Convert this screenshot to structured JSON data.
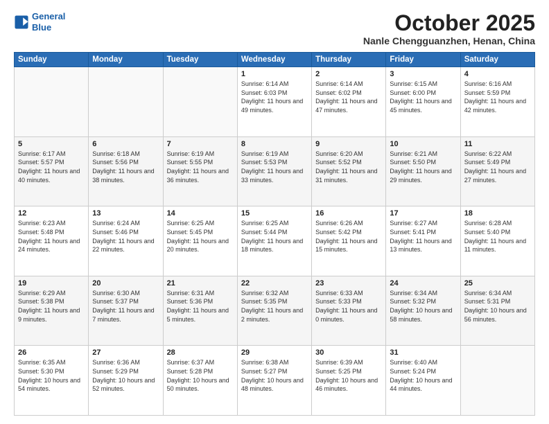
{
  "header": {
    "logo_line1": "General",
    "logo_line2": "Blue",
    "month": "October 2025",
    "location": "Nanle Chengguanzhen, Henan, China"
  },
  "weekdays": [
    "Sunday",
    "Monday",
    "Tuesday",
    "Wednesday",
    "Thursday",
    "Friday",
    "Saturday"
  ],
  "weeks": [
    [
      {
        "day": "",
        "info": ""
      },
      {
        "day": "",
        "info": ""
      },
      {
        "day": "",
        "info": ""
      },
      {
        "day": "1",
        "info": "Sunrise: 6:14 AM\nSunset: 6:03 PM\nDaylight: 11 hours\nand 49 minutes."
      },
      {
        "day": "2",
        "info": "Sunrise: 6:14 AM\nSunset: 6:02 PM\nDaylight: 11 hours\nand 47 minutes."
      },
      {
        "day": "3",
        "info": "Sunrise: 6:15 AM\nSunset: 6:00 PM\nDaylight: 11 hours\nand 45 minutes."
      },
      {
        "day": "4",
        "info": "Sunrise: 6:16 AM\nSunset: 5:59 PM\nDaylight: 11 hours\nand 42 minutes."
      }
    ],
    [
      {
        "day": "5",
        "info": "Sunrise: 6:17 AM\nSunset: 5:57 PM\nDaylight: 11 hours\nand 40 minutes."
      },
      {
        "day": "6",
        "info": "Sunrise: 6:18 AM\nSunset: 5:56 PM\nDaylight: 11 hours\nand 38 minutes."
      },
      {
        "day": "7",
        "info": "Sunrise: 6:19 AM\nSunset: 5:55 PM\nDaylight: 11 hours\nand 36 minutes."
      },
      {
        "day": "8",
        "info": "Sunrise: 6:19 AM\nSunset: 5:53 PM\nDaylight: 11 hours\nand 33 minutes."
      },
      {
        "day": "9",
        "info": "Sunrise: 6:20 AM\nSunset: 5:52 PM\nDaylight: 11 hours\nand 31 minutes."
      },
      {
        "day": "10",
        "info": "Sunrise: 6:21 AM\nSunset: 5:50 PM\nDaylight: 11 hours\nand 29 minutes."
      },
      {
        "day": "11",
        "info": "Sunrise: 6:22 AM\nSunset: 5:49 PM\nDaylight: 11 hours\nand 27 minutes."
      }
    ],
    [
      {
        "day": "12",
        "info": "Sunrise: 6:23 AM\nSunset: 5:48 PM\nDaylight: 11 hours\nand 24 minutes."
      },
      {
        "day": "13",
        "info": "Sunrise: 6:24 AM\nSunset: 5:46 PM\nDaylight: 11 hours\nand 22 minutes."
      },
      {
        "day": "14",
        "info": "Sunrise: 6:25 AM\nSunset: 5:45 PM\nDaylight: 11 hours\nand 20 minutes."
      },
      {
        "day": "15",
        "info": "Sunrise: 6:25 AM\nSunset: 5:44 PM\nDaylight: 11 hours\nand 18 minutes."
      },
      {
        "day": "16",
        "info": "Sunrise: 6:26 AM\nSunset: 5:42 PM\nDaylight: 11 hours\nand 15 minutes."
      },
      {
        "day": "17",
        "info": "Sunrise: 6:27 AM\nSunset: 5:41 PM\nDaylight: 11 hours\nand 13 minutes."
      },
      {
        "day": "18",
        "info": "Sunrise: 6:28 AM\nSunset: 5:40 PM\nDaylight: 11 hours\nand 11 minutes."
      }
    ],
    [
      {
        "day": "19",
        "info": "Sunrise: 6:29 AM\nSunset: 5:38 PM\nDaylight: 11 hours\nand 9 minutes."
      },
      {
        "day": "20",
        "info": "Sunrise: 6:30 AM\nSunset: 5:37 PM\nDaylight: 11 hours\nand 7 minutes."
      },
      {
        "day": "21",
        "info": "Sunrise: 6:31 AM\nSunset: 5:36 PM\nDaylight: 11 hours\nand 5 minutes."
      },
      {
        "day": "22",
        "info": "Sunrise: 6:32 AM\nSunset: 5:35 PM\nDaylight: 11 hours\nand 2 minutes."
      },
      {
        "day": "23",
        "info": "Sunrise: 6:33 AM\nSunset: 5:33 PM\nDaylight: 11 hours\nand 0 minutes."
      },
      {
        "day": "24",
        "info": "Sunrise: 6:34 AM\nSunset: 5:32 PM\nDaylight: 10 hours\nand 58 minutes."
      },
      {
        "day": "25",
        "info": "Sunrise: 6:34 AM\nSunset: 5:31 PM\nDaylight: 10 hours\nand 56 minutes."
      }
    ],
    [
      {
        "day": "26",
        "info": "Sunrise: 6:35 AM\nSunset: 5:30 PM\nDaylight: 10 hours\nand 54 minutes."
      },
      {
        "day": "27",
        "info": "Sunrise: 6:36 AM\nSunset: 5:29 PM\nDaylight: 10 hours\nand 52 minutes."
      },
      {
        "day": "28",
        "info": "Sunrise: 6:37 AM\nSunset: 5:28 PM\nDaylight: 10 hours\nand 50 minutes."
      },
      {
        "day": "29",
        "info": "Sunrise: 6:38 AM\nSunset: 5:27 PM\nDaylight: 10 hours\nand 48 minutes."
      },
      {
        "day": "30",
        "info": "Sunrise: 6:39 AM\nSunset: 5:25 PM\nDaylight: 10 hours\nand 46 minutes."
      },
      {
        "day": "31",
        "info": "Sunrise: 6:40 AM\nSunset: 5:24 PM\nDaylight: 10 hours\nand 44 minutes."
      },
      {
        "day": "",
        "info": ""
      }
    ]
  ]
}
